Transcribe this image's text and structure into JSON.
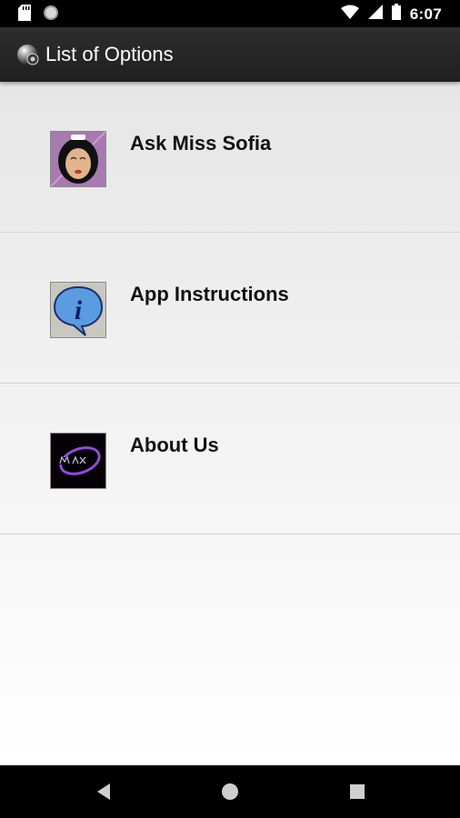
{
  "status_bar": {
    "time": "6:07",
    "icons": [
      "sd-card-icon",
      "circle-notification-icon",
      "wifi-icon",
      "cell-signal-icon",
      "battery-icon"
    ]
  },
  "app_bar": {
    "title": "List of Options",
    "icon": "app-logo-icon"
  },
  "options": [
    {
      "label": "Ask Miss Sofia",
      "icon": "miss-sofia-avatar"
    },
    {
      "label": "App Instructions",
      "icon": "info-bubble-icon"
    },
    {
      "label": "About Us",
      "icon": "maxsoft-logo"
    }
  ],
  "nav_bar": {
    "buttons": [
      "back-button",
      "home-button",
      "recents-button"
    ]
  },
  "colors": {
    "app_bar": "#262626",
    "content_top": "#e6e6e6",
    "content_bottom": "#ffffff",
    "info_blue": "#5b9be0",
    "logo_purple": "#8a4fd0"
  }
}
